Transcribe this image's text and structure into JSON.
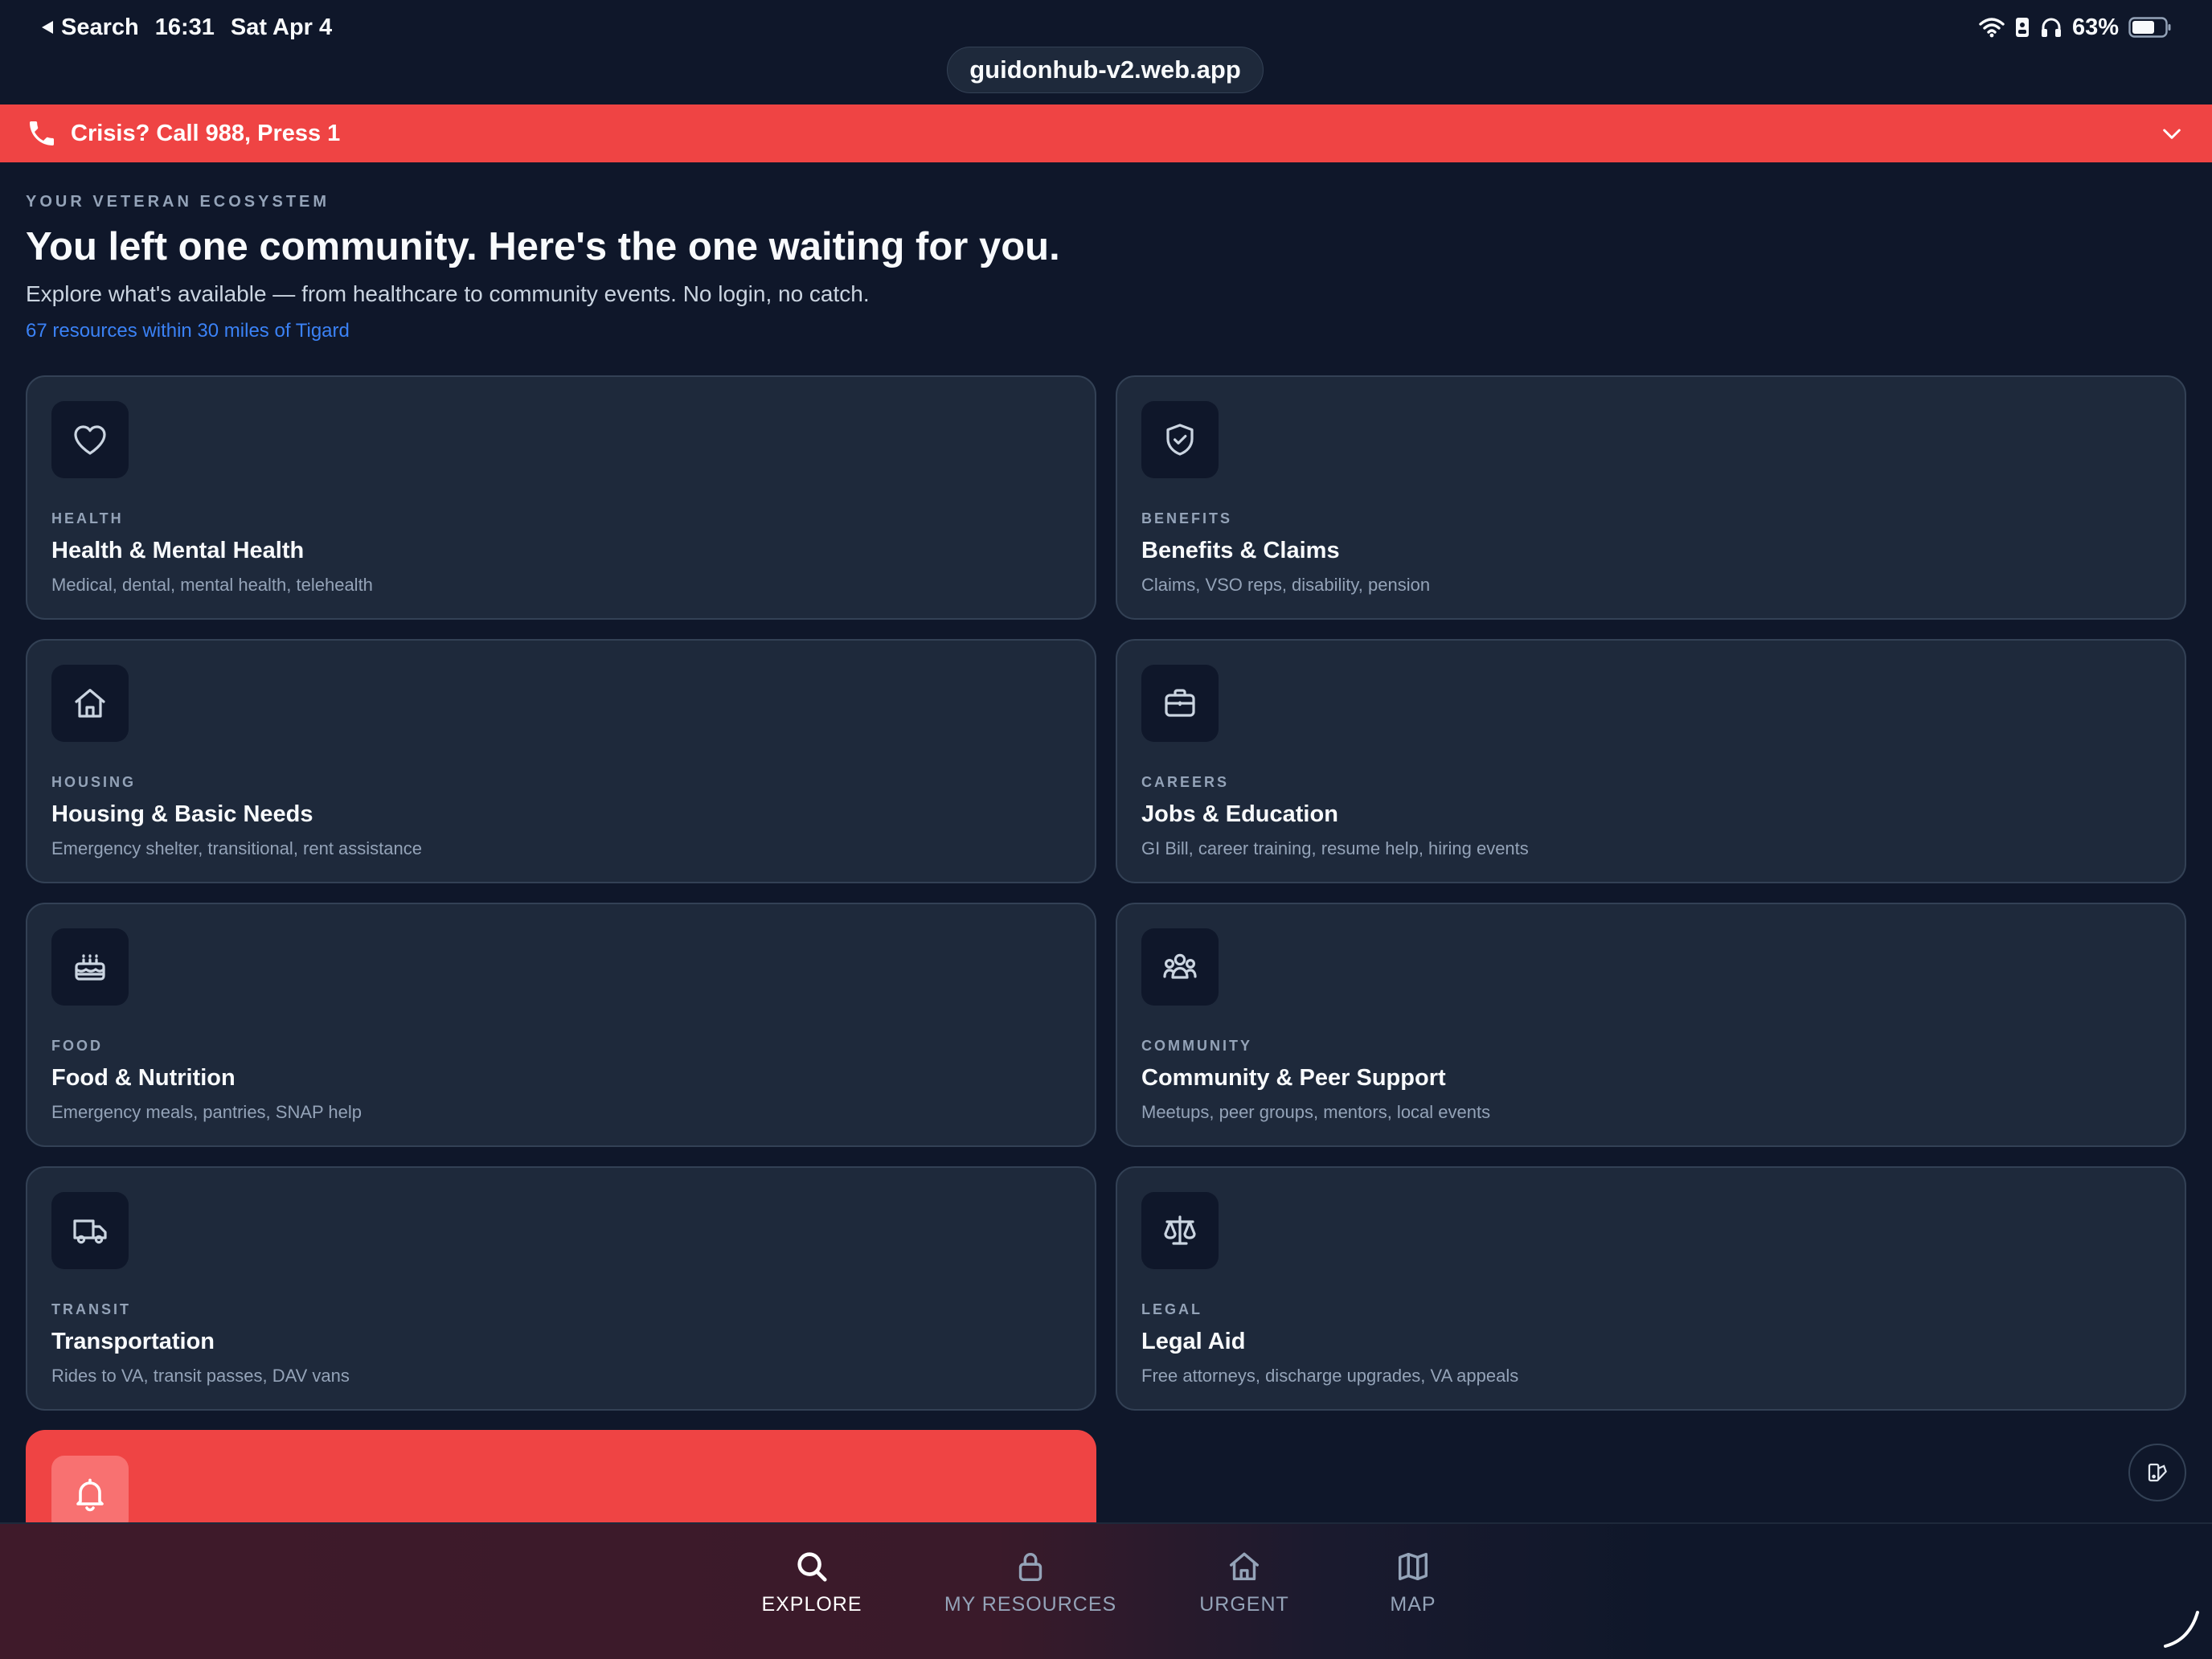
{
  "status_bar": {
    "back_label": "Search",
    "time": "16:31",
    "date": "Sat Apr 4",
    "battery": "63%"
  },
  "browser": {
    "url": "guidonhub-v2.web.app"
  },
  "crisis": {
    "text": "Crisis? Call 988, Press 1"
  },
  "hero": {
    "eyebrow": "YOUR VETERAN ECOSYSTEM",
    "title": "You left one community. Here's the one waiting for you.",
    "subtitle": "Explore what's available — from healthcare to community events. No login, no catch.",
    "count": "67 resources within 30 miles of Tigard"
  },
  "categories": [
    {
      "eyebrow": "HEALTH",
      "title": "Health & Mental Health",
      "desc": "Medical, dental, mental health, telehealth",
      "icon": "heart-icon"
    },
    {
      "eyebrow": "BENEFITS",
      "title": "Benefits & Claims",
      "desc": "Claims, VSO reps, disability, pension",
      "icon": "shield-check-icon"
    },
    {
      "eyebrow": "HOUSING",
      "title": "Housing & Basic Needs",
      "desc": "Emergency shelter, transitional, rent assistance",
      "icon": "home-icon"
    },
    {
      "eyebrow": "CAREERS",
      "title": "Jobs & Education",
      "desc": "GI Bill, career training, resume help, hiring events",
      "icon": "briefcase-icon"
    },
    {
      "eyebrow": "FOOD",
      "title": "Food & Nutrition",
      "desc": "Emergency meals, pantries, SNAP help",
      "icon": "cake-icon"
    },
    {
      "eyebrow": "COMMUNITY",
      "title": "Community & Peer Support",
      "desc": "Meetups, peer groups, mentors, local events",
      "icon": "users-icon"
    },
    {
      "eyebrow": "TRANSIT",
      "title": "Transportation",
      "desc": "Rides to VA, transit passes, DAV vans",
      "icon": "truck-icon"
    },
    {
      "eyebrow": "LEGAL",
      "title": "Legal Aid",
      "desc": "Free attorneys, discharge upgrades, VA appeals",
      "icon": "scale-icon"
    }
  ],
  "urgent_card": {
    "icon": "bell-icon"
  },
  "nav": {
    "explore": "EXPLORE",
    "resources": "MY RESOURCES",
    "urgent": "URGENT",
    "map": "MAP"
  },
  "colors": {
    "background": "#0f172a",
    "card": "#1e293b",
    "crisis": "#ef4444",
    "link": "#3b82f6"
  }
}
